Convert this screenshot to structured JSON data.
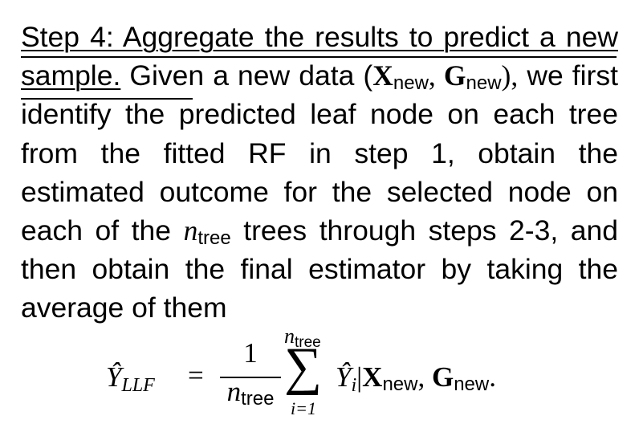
{
  "heading": "Step 4: Aggregate the results to predict a new sample.",
  "intro_before_tuple": "Given a new data (",
  "tuple": {
    "x_symbol": "X",
    "g_symbol": "G",
    "subscript": "new",
    "separator": ", "
  },
  "intro_close": "),",
  "body_part1": "we first identify the predicted leaf node on each tree from the fitted RF in step 1, obtain the estimated outcome for the selected node on each of the",
  "n_symbol": "n",
  "n_subscript": "tree",
  "body_part2": "trees through steps 2-3, and then obtain the final estimator by taking the average of them",
  "equation": {
    "lhs_symbol": "Ŷ",
    "lhs_subscript": "LLF",
    "equals": "=",
    "numerator": "1",
    "denominator_symbol": "n",
    "denominator_subscript": "tree",
    "sum_symbol": "∑",
    "sum_upper_symbol": "n",
    "sum_upper_subscript": "tree",
    "sum_lower": "i=1",
    "term_symbol": "Ŷ",
    "term_subscript": "i",
    "given": "|",
    "x_symbol": "X",
    "g_symbol": "G",
    "cond_subscript": "new",
    "comma": ", ",
    "end": "."
  }
}
